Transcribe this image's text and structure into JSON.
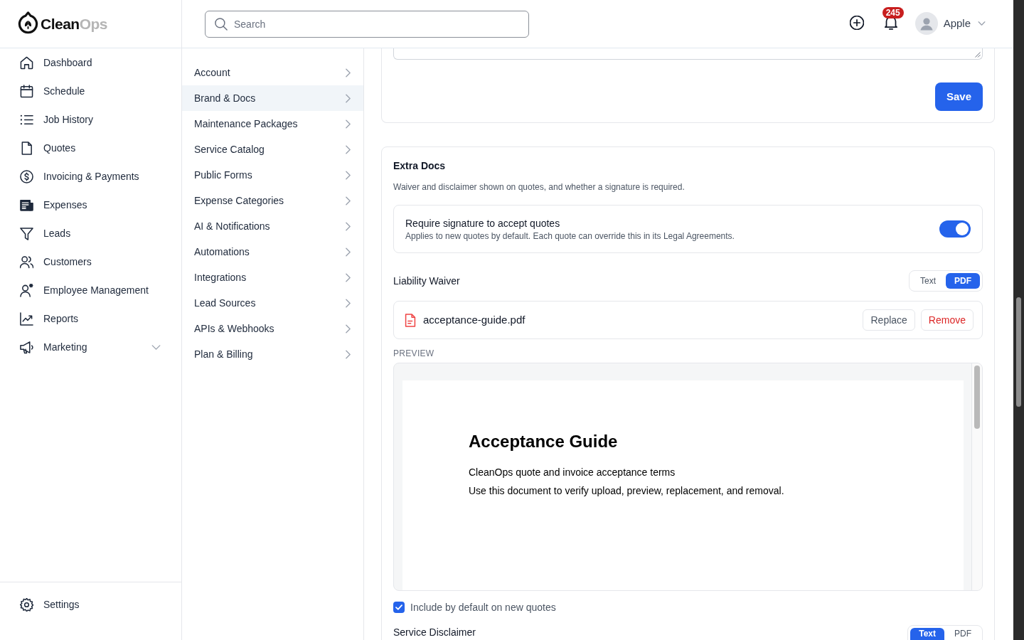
{
  "logo": {
    "dark_part": "Clean",
    "light_part": "Ops"
  },
  "sidebar": {
    "items": [
      {
        "label": "Dashboard",
        "kind": "link"
      },
      {
        "label": "Schedule",
        "kind": "link"
      },
      {
        "label": "Job History",
        "kind": "link"
      },
      {
        "label": "Quotes",
        "kind": "link"
      },
      {
        "label": "Invoicing & Payments",
        "kind": "link"
      },
      {
        "label": "Expenses",
        "kind": "link"
      },
      {
        "label": "Leads",
        "kind": "link"
      },
      {
        "label": "Customers",
        "kind": "link"
      },
      {
        "label": "Employee Management",
        "kind": "link"
      },
      {
        "label": "Reports",
        "kind": "link"
      },
      {
        "label": "Marketing",
        "kind": "group",
        "expanded": false
      }
    ],
    "footer": {
      "label": "Settings"
    }
  },
  "topbar": {
    "search": {
      "placeholder": "Search"
    },
    "notifications": {
      "count": "245"
    },
    "user": {
      "name": "Apple"
    }
  },
  "settings_nav": {
    "items": [
      {
        "label": "Account",
        "selected": false
      },
      {
        "label": "Brand & Docs",
        "selected": true
      },
      {
        "label": "Maintenance Packages",
        "selected": false
      },
      {
        "label": "Service Catalog",
        "selected": false
      },
      {
        "label": "Public Forms",
        "selected": false
      },
      {
        "label": "Expense Categories",
        "selected": false
      },
      {
        "label": "AI & Notifications",
        "selected": false
      },
      {
        "label": "Automations",
        "selected": false
      },
      {
        "label": "Integrations",
        "selected": false
      },
      {
        "label": "Lead Sources",
        "selected": false
      },
      {
        "label": "APIs & Webhooks",
        "selected": false
      },
      {
        "label": "Plan & Billing",
        "selected": false
      }
    ]
  },
  "form_card": {
    "save_button": "Save"
  },
  "extra_docs": {
    "title": "Extra Docs",
    "description": "Waiver and disclaimer shown on quotes, and whether a signature is required.",
    "signature_setting": {
      "label": "Require signature to accept quotes",
      "hint": "Applies to new quotes by default. Each quote can override this in its Legal Agreements.",
      "on": true
    },
    "liability_waiver": {
      "title": "Liability Waiver",
      "modes": [
        {
          "label": "Text",
          "selected": false
        },
        {
          "label": "PDF",
          "selected": true
        }
      ],
      "file": {
        "name": "acceptance-guide.pdf",
        "actions": [
          {
            "label": "Replace",
            "kind": "neutral"
          },
          {
            "label": "Remove",
            "kind": "danger"
          }
        ]
      },
      "preview_label": "PREVIEW",
      "preview": {
        "title": "Acceptance Guide",
        "lines": [
          "CleanOps quote and invoice acceptance terms",
          "Use this document to verify upload, preview, replacement, and removal."
        ]
      },
      "include_by_default": {
        "label": "Include by default on new quotes",
        "checked": true
      }
    },
    "service_disclaimer": {
      "title": "Service Disclaimer",
      "modes": [
        {
          "label": "Text",
          "selected": true
        },
        {
          "label": "PDF",
          "selected": false
        }
      ]
    }
  }
}
